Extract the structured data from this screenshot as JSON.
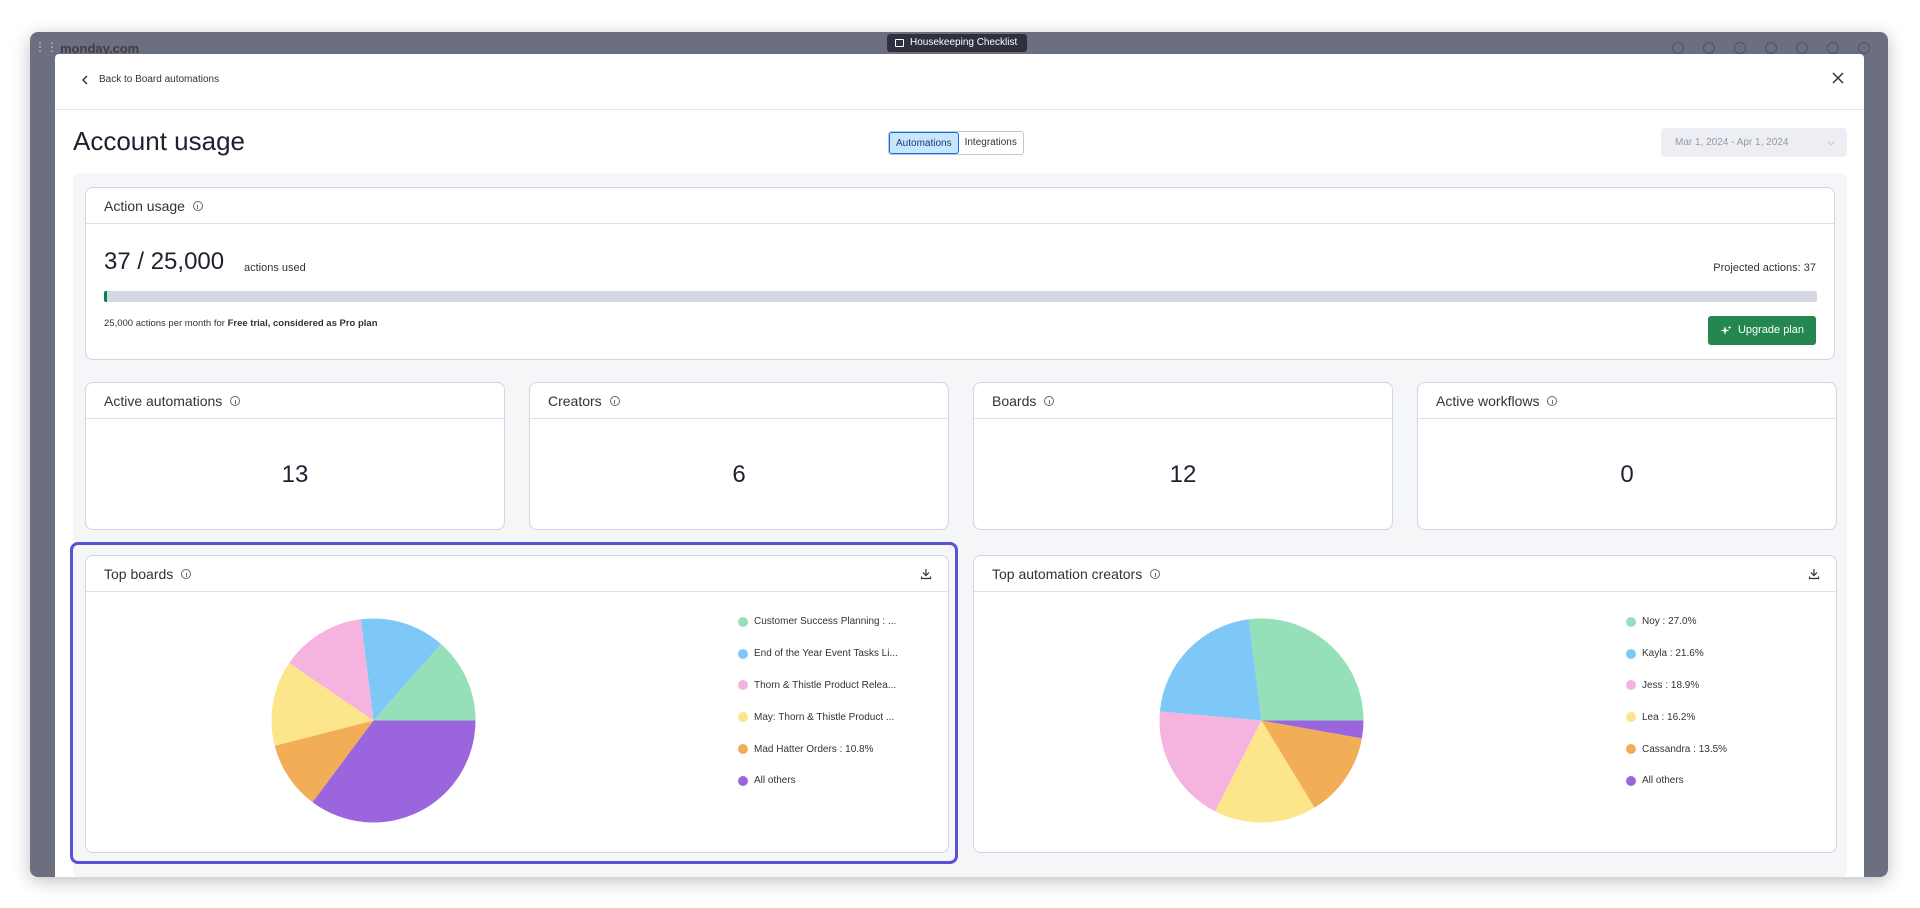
{
  "app": {
    "brand": "monday.com",
    "board_chip": "Housekeeping Checklist"
  },
  "header": {
    "back_label": "Back to Board automations",
    "title": "Account usage",
    "tabs": [
      {
        "label": "Automations",
        "active": true
      },
      {
        "label": "Integrations",
        "active": false
      }
    ],
    "date_range": "Mar 1, 2024 - Apr 1, 2024"
  },
  "action_usage": {
    "title": "Action usage",
    "used": "37 / 25,000",
    "used_suffix": "actions used",
    "projected": "Projected actions: 37",
    "progress_fraction": 0.0015,
    "plan_note_prefix": "25,000 actions per month for ",
    "plan_note_bold": "Free trial, considered as Pro plan",
    "upgrade_label": "Upgrade plan"
  },
  "stats": [
    {
      "label": "Active automations",
      "value": "13"
    },
    {
      "label": "Creators",
      "value": "6"
    },
    {
      "label": "Boards",
      "value": "12"
    },
    {
      "label": "Active workflows",
      "value": "0"
    }
  ],
  "chart_data": [
    {
      "type": "pie",
      "title": "Top boards",
      "labels": [
        "Customer Success Planning : ...",
        "End of the Year Event Tasks Li...",
        "Thorn & Thistle Product Relea...",
        "May: Thorn & Thistle Product ...",
        "Mad Hatter Orders : 10.8%",
        "All others"
      ],
      "values": [
        13.5,
        13.5,
        13.5,
        13.5,
        10.8,
        35.2
      ],
      "colors": [
        "#95e0b8",
        "#7ec8f8",
        "#f5b3e0",
        "#fde58c",
        "#f2ae57",
        "#9b66dd"
      ]
    },
    {
      "type": "pie",
      "title": "Top automation creators",
      "labels": [
        "Noy : 27.0%",
        "Kayla : 21.6%",
        "Jess : 18.9%",
        "Lea : 16.2%",
        "Cassandra : 13.5%",
        "All others"
      ],
      "values": [
        27.0,
        21.6,
        18.9,
        16.2,
        13.5,
        2.8
      ],
      "colors": [
        "#95e0b8",
        "#7ec8f8",
        "#f5b3e0",
        "#fde58c",
        "#f2ae57",
        "#9b66dd"
      ]
    }
  ]
}
